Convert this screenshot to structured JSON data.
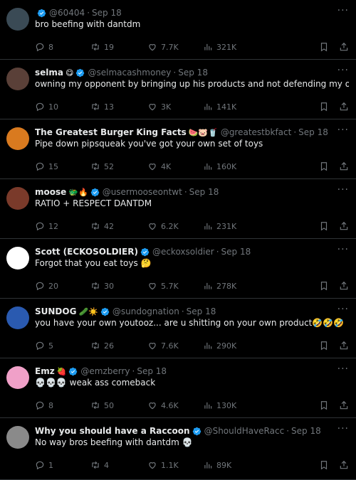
{
  "colors": {
    "background": "#000000",
    "text": "#e7e9ea",
    "muted": "#71767b",
    "verified": "#1d9bf0",
    "divider": "#2f3336"
  },
  "tweets": [
    {
      "name": "",
      "emojis": "",
      "handle": "@60404",
      "time": "Sep 18",
      "text": "bro beefing with dantdm",
      "replies": "8",
      "retweets": "19",
      "likes": "7.7K",
      "views": "321K",
      "verified": true
    },
    {
      "name": "selma",
      "emojis": "😋",
      "handle": "@selmacashmoney",
      "time": "Sep 18",
      "text": "owning my opponent by bringing up his products and not defending my own",
      "replies": "10",
      "retweets": "13",
      "likes": "3K",
      "views": "141K",
      "verified": true
    },
    {
      "name": "The Greatest Burger King Facts",
      "emojis": "🍉🐷🥤",
      "handle": "@greatestbkfact",
      "time": "Sep 18",
      "text": "Pipe down pipsqueak you've got your own set of toys",
      "replies": "15",
      "retweets": "52",
      "likes": "4K",
      "views": "160K",
      "verified": false
    },
    {
      "name": "moose",
      "emojis": "🐲🔥",
      "handle": "@usermooseontwt",
      "time": "Sep 18",
      "text": "RATIO + RESPECT DANTDM",
      "replies": "12",
      "retweets": "42",
      "likes": "6.2K",
      "views": "231K",
      "verified": true
    },
    {
      "name": "Scott (ECKOSOLDIER)",
      "emojis": "",
      "handle": "@eckoxsoldier",
      "time": "Sep 18",
      "text": "Forgot that you eat toys 🤔",
      "replies": "20",
      "retweets": "30",
      "likes": "5.7K",
      "views": "278K",
      "verified": true
    },
    {
      "name": "SUNDOG",
      "emojis": "🥒☀️",
      "handle": "@sundognation",
      "time": "Sep 18",
      "text": "you have your own youtooz... are u shitting on your own product🤣🤣🤣",
      "replies": "5",
      "retweets": "26",
      "likes": "7.6K",
      "views": "290K",
      "verified": true
    },
    {
      "name": "Emz",
      "emojis": "🍓",
      "handle": "@emzberry",
      "time": "Sep 18",
      "text": "💀💀💀 weak ass comeback",
      "replies": "8",
      "retweets": "50",
      "likes": "4.6K",
      "views": "130K",
      "verified": true
    },
    {
      "name": "Why you should have a Raccoon",
      "emojis": "",
      "handle": "@ShouldHaveRacc",
      "time": "Sep 18",
      "text": "No way bros beefing with dantdm 💀",
      "replies": "1",
      "retweets": "4",
      "likes": "1.1K",
      "views": "89K",
      "verified": true
    }
  ],
  "avatars": [
    "#3a4a55",
    "#5a4038",
    "#d97a1f",
    "#7a3a2a",
    "#ffffff",
    "#2a5ab0",
    "#f0a0c8",
    "#8a8a8a"
  ],
  "icons": {
    "reply": "reply-icon",
    "retweet": "retweet-icon",
    "like": "heart-icon",
    "views": "views-icon",
    "bookmark": "bookmark-icon",
    "share": "share-icon",
    "more": "more-icon",
    "verified": "verified-badge-icon"
  }
}
